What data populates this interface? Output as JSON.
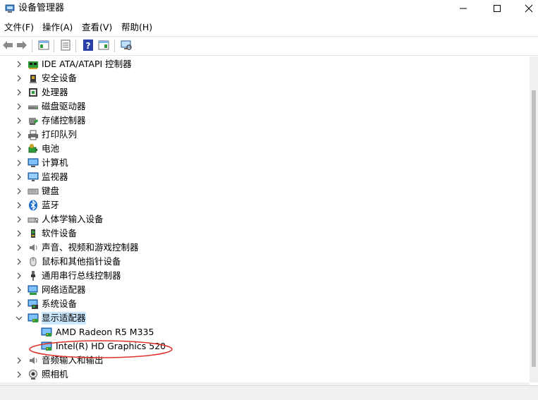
{
  "window": {
    "title": "设备管理器",
    "icon": "device-manager-icon",
    "controls": [
      "minimize-icon",
      "maximize-icon",
      "close-icon"
    ]
  },
  "menu": {
    "file": "文件(F)",
    "action": "操作(A)",
    "view": "查看(V)",
    "help": "帮助(H)"
  },
  "toolbar": {
    "buttons": [
      "back-icon",
      "forward-icon",
      "show-hide-console-tree-icon",
      "properties-icon",
      "help-icon",
      "action-pane-icon",
      "scan-hardware-icon"
    ]
  },
  "tree": {
    "categories": [
      {
        "label": "IDE ATA/ATAPI 控制器",
        "icon": "ide-controller-icon",
        "expanded": false
      },
      {
        "label": "安全设备",
        "icon": "security-device-icon",
        "expanded": false
      },
      {
        "label": "处理器",
        "icon": "processor-icon",
        "expanded": false
      },
      {
        "label": "磁盘驱动器",
        "icon": "disk-drive-icon",
        "expanded": false
      },
      {
        "label": "存储控制器",
        "icon": "storage-controller-icon",
        "expanded": false
      },
      {
        "label": "打印队列",
        "icon": "printer-icon",
        "expanded": false
      },
      {
        "label": "电池",
        "icon": "battery-icon",
        "expanded": false
      },
      {
        "label": "计算机",
        "icon": "computer-icon",
        "expanded": false
      },
      {
        "label": "监视器",
        "icon": "monitor-icon",
        "expanded": false
      },
      {
        "label": "键盘",
        "icon": "keyboard-icon",
        "expanded": false
      },
      {
        "label": "蓝牙",
        "icon": "bluetooth-icon",
        "expanded": false
      },
      {
        "label": "人体学输入设备",
        "icon": "hid-icon",
        "expanded": false
      },
      {
        "label": "软件设备",
        "icon": "software-device-icon",
        "expanded": false
      },
      {
        "label": "声音、视频和游戏控制器",
        "icon": "speaker-icon",
        "expanded": false
      },
      {
        "label": "鼠标和其他指针设备",
        "icon": "mouse-icon",
        "expanded": false
      },
      {
        "label": "通用串行总线控制器",
        "icon": "usb-icon",
        "expanded": false
      },
      {
        "label": "网络适配器",
        "icon": "network-adapter-icon",
        "expanded": false
      },
      {
        "label": "系统设备",
        "icon": "system-device-icon",
        "expanded": false
      },
      {
        "label": "显示适配器",
        "icon": "display-adapter-icon",
        "expanded": true,
        "selected": true
      }
    ],
    "display_adapters": [
      {
        "label": "AMD Radeon R5 M335",
        "icon": "display-adapter-icon"
      },
      {
        "label": "Intel(R) HD Graphics 520",
        "icon": "display-adapter-icon",
        "circled": true
      }
    ],
    "after_categories": [
      {
        "label": "音频输入和输出",
        "icon": "audio-io-icon",
        "expanded": false
      },
      {
        "label": "照相机",
        "icon": "camera-icon",
        "expanded": false
      }
    ]
  },
  "colors": {
    "selection": "#cce8ff",
    "annotation": "#e0302a",
    "icon_blue": "#2f7fd6",
    "icon_green": "#2e9b3a"
  }
}
